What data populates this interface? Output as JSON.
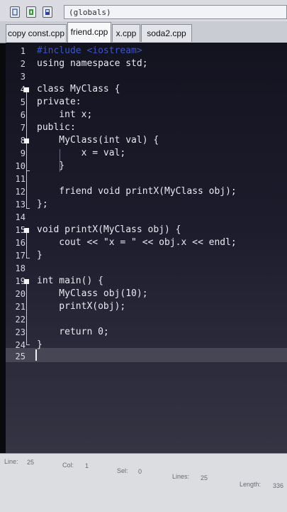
{
  "toolbar": {
    "scope_value": "(globals)",
    "buttons": [
      {
        "icon": "new-file-icon"
      },
      {
        "icon": "add-file-icon"
      },
      {
        "icon": "save-icon"
      }
    ]
  },
  "tabs": [
    {
      "label": "copy const.cpp",
      "active": false
    },
    {
      "label": "friend.cpp",
      "active": true
    },
    {
      "label": "x.cpp",
      "active": false
    },
    {
      "label": "soda2.cpp",
      "active": false
    }
  ],
  "editor": {
    "line_numbers": [
      "1",
      "2",
      "3",
      "4",
      "5",
      "6",
      "7",
      "8",
      "9",
      "10",
      "11",
      "12",
      "13",
      "14",
      "15",
      "16",
      "17",
      "18",
      "19",
      "20",
      "21",
      "22",
      "23",
      "24",
      "25"
    ],
    "lines": [
      {
        "n": "1",
        "text": "#include <iostream>"
      },
      {
        "n": "2",
        "text": "using namespace std;"
      },
      {
        "n": "4",
        "text": "class MyClass {"
      },
      {
        "n": "5",
        "text": "private:"
      },
      {
        "n": "6",
        "text": "    int x;"
      },
      {
        "n": "7",
        "text": "public:"
      },
      {
        "n": "8",
        "text": "    MyClass(int val) {"
      },
      {
        "n": "9",
        "text": "        x = val;"
      },
      {
        "n": "10",
        "text": "    }"
      },
      {
        "n": "12",
        "text": "    friend void printX(MyClass obj);"
      },
      {
        "n": "13",
        "text": "};"
      },
      {
        "n": "15",
        "text": "void printX(MyClass obj) {"
      },
      {
        "n": "16",
        "text": "    cout << \"x = \" << obj.x << endl;"
      },
      {
        "n": "17",
        "text": "}"
      },
      {
        "n": "19",
        "text": "int main() {"
      },
      {
        "n": "20",
        "text": "    MyClass obj(10);"
      },
      {
        "n": "21",
        "text": "    printX(obj);"
      },
      {
        "n": "23",
        "text": "    return 0;"
      },
      {
        "n": "24",
        "text": "}"
      }
    ],
    "current_line": "25"
  },
  "status": {
    "line_label": "Line:",
    "line_value": "25",
    "col_label": "Col:",
    "col_value": "1",
    "sel_label": "Sel:",
    "sel_value": "0",
    "lines_label": "Lines:",
    "lines_value": "25",
    "length_label": "Length:",
    "length_value": "336"
  },
  "colors": {
    "preprocessor": "#3c54c9",
    "editor_bg": "#1c1c2c",
    "text": "#e9e9f2"
  }
}
